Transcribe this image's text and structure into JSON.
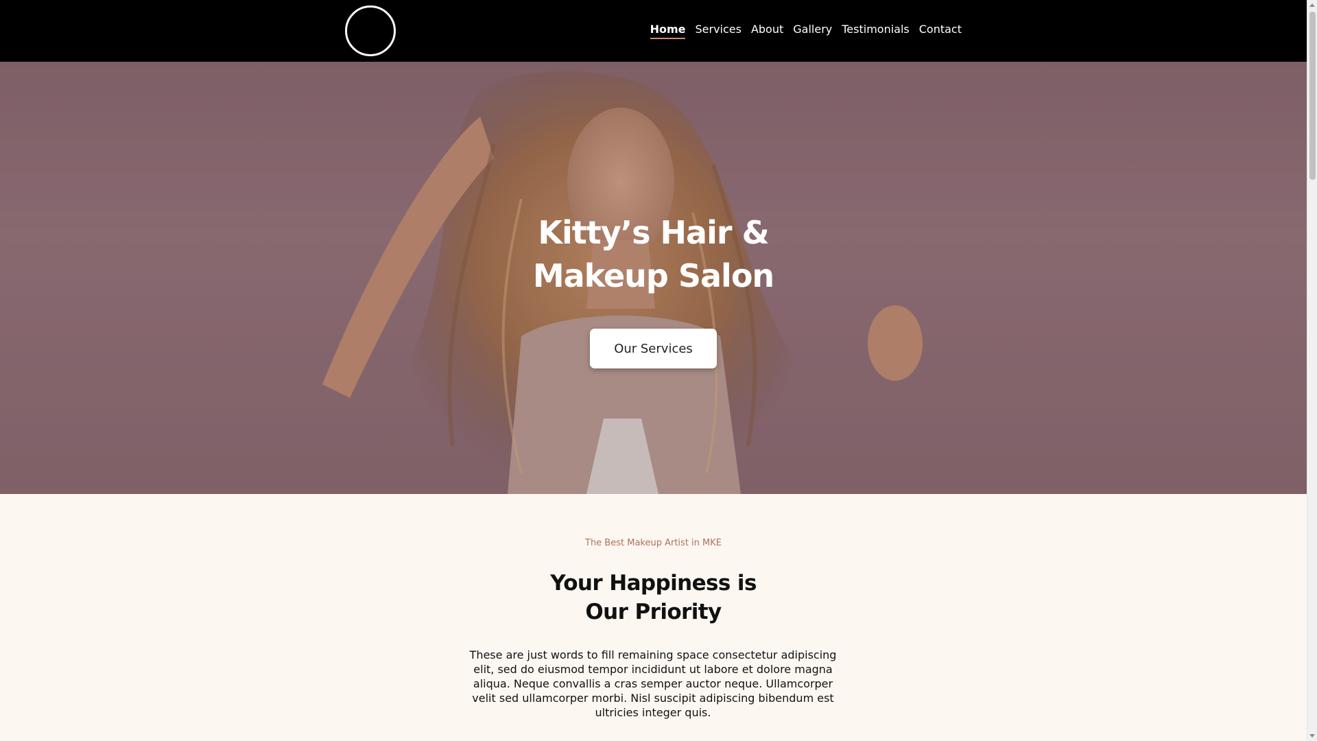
{
  "header": {
    "nav": [
      {
        "label": "Home"
      },
      {
        "label": "Services"
      },
      {
        "label": "About"
      },
      {
        "label": "Gallery"
      },
      {
        "label": "Testimonials"
      },
      {
        "label": "Contact"
      }
    ],
    "active_nav": "Home"
  },
  "hero": {
    "title_line1": "Kitty’s Hair &",
    "title_line2": "Makeup Salon",
    "button_label": "Our Services"
  },
  "intro": {
    "tagline": "The Best Makeup Artist in MKE",
    "title_line1": "Your Happiness is",
    "title_line2": "Our Priority",
    "body": "These are just words to fill remaining space consectetur adipiscing elit, sed do eiusmod tempor incididunt ut labore et dolore magna aliqua. Neque convallis a cras semper auctor neque. Ullamcorper velit sed ullamcorper morbi. Nisl suscipit adipiscing bibendum est ultricies integer quis."
  },
  "colors": {
    "header_bg": "#000000",
    "accent": "#d08b6c",
    "tagline": "#b2705b",
    "page_bg": "#fdf7f2"
  },
  "icons": [
    "logo-circle-icon"
  ]
}
